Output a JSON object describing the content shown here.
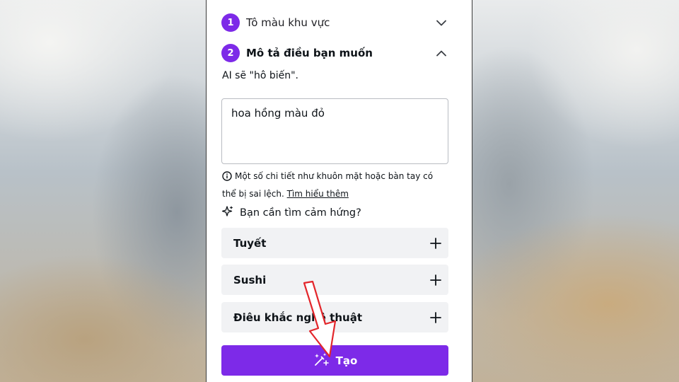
{
  "steps": [
    {
      "number": "1",
      "title": "Tô màu khu vực",
      "expanded": false
    },
    {
      "number": "2",
      "title": "Mô tả điều bạn muốn",
      "expanded": true
    }
  ],
  "description": "AI sẽ \"hô biến\".",
  "prompt": {
    "value": "hoa hồng màu đỏ"
  },
  "note": {
    "text": "Một số chi tiết như khuôn mặt hoặc bàn tay có thể bị sai lệch.",
    "link": "Tìm hiểu thêm"
  },
  "inspiration": {
    "label": "Bạn cần tìm cảm hứng?"
  },
  "suggestions": [
    "Tuyết",
    "Sushi",
    "Điêu khắc nghệ thuật"
  ],
  "create_button": {
    "label": "Tạo"
  },
  "colors": {
    "accent": "#7d2ae8",
    "suggestion_bg": "#f1f2f4",
    "annotation_arrow": "#e3262b"
  },
  "icons": [
    "chevron-down-icon",
    "chevron-up-icon",
    "info-icon",
    "sparkle-icon",
    "plus-icon",
    "magic-wand-icon"
  ]
}
